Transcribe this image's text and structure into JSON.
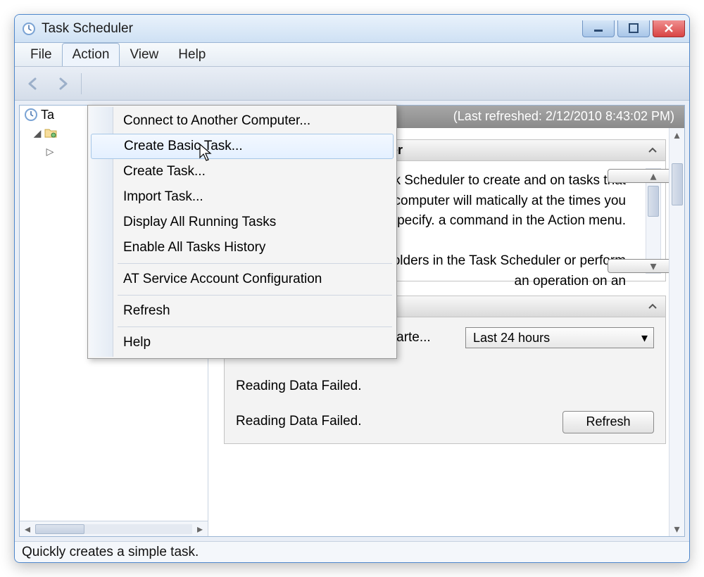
{
  "window": {
    "title": "Task Scheduler"
  },
  "menubar": {
    "file": "File",
    "action": "Action",
    "view": "View",
    "help": "Help"
  },
  "action_menu": {
    "items": [
      "Connect to Another Computer...",
      "Create Basic Task...",
      "Create Task...",
      "Import Task...",
      "Display All Running Tasks",
      "Enable All Tasks History",
      "AT Service Account Configuration",
      "Refresh",
      "Help"
    ]
  },
  "tree": {
    "root_label": "Ta"
  },
  "summary": {
    "last_refreshed": "(Last refreshed: 2/12/2010 8:43:02 PM)"
  },
  "overview": {
    "heading_partial": "uler",
    "text_partial": "sk Scheduler to create and on tasks that your computer will matically at the times you specify. a command in the Action menu.\n\nd in folders in the Task Scheduler or perform an operation on an"
  },
  "task_status": {
    "label": "Status of tasks that have starte...",
    "dropdown_value": "Last 24 hours",
    "fail1": "Reading Data Failed.",
    "fail2": "Reading Data Failed.",
    "refresh_btn": "Refresh"
  },
  "statusbar": {
    "text": "Quickly creates a simple task."
  }
}
